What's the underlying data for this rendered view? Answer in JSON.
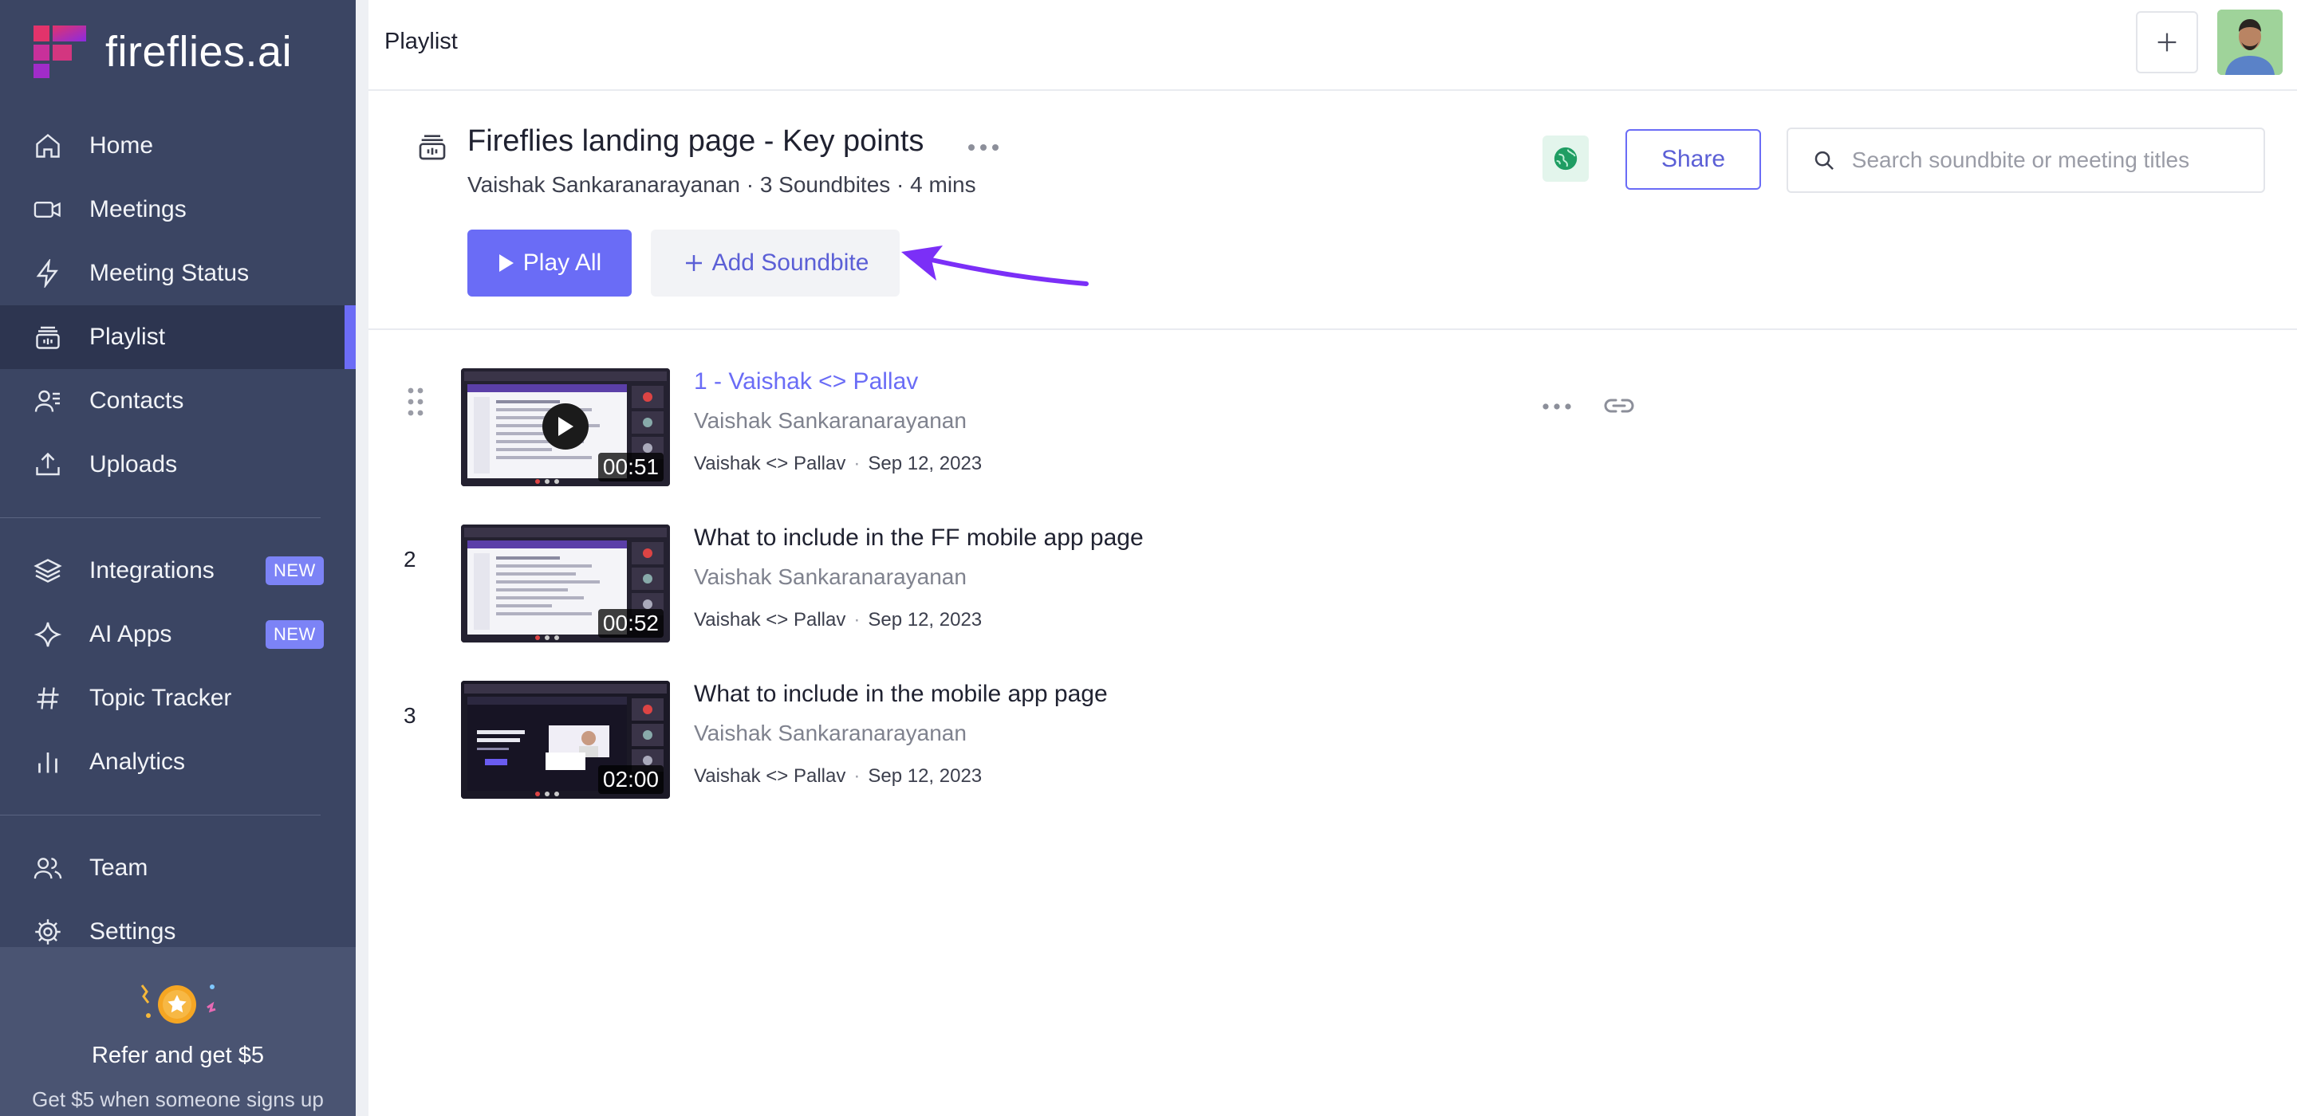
{
  "app": {
    "name": "fireflies.ai"
  },
  "colors": {
    "sidebar": "#3b4563",
    "accent": "#6a6cf6",
    "active": "#2d3550"
  },
  "sidebar": {
    "items": [
      {
        "label": "Home",
        "icon": "home-icon"
      },
      {
        "label": "Meetings",
        "icon": "video-icon"
      },
      {
        "label": "Meeting Status",
        "icon": "bolt-icon"
      },
      {
        "label": "Playlist",
        "icon": "playlist-icon",
        "active": true
      },
      {
        "label": "Contacts",
        "icon": "contacts-icon"
      },
      {
        "label": "Uploads",
        "icon": "upload-icon"
      }
    ],
    "items2": [
      {
        "label": "Integrations",
        "icon": "layers-icon",
        "badge": "NEW"
      },
      {
        "label": "AI Apps",
        "icon": "sparkle-icon",
        "badge": "NEW"
      },
      {
        "label": "Topic Tracker",
        "icon": "hash-icon"
      },
      {
        "label": "Analytics",
        "icon": "bar-chart-icon"
      }
    ],
    "items3": [
      {
        "label": "Team",
        "icon": "team-icon"
      },
      {
        "label": "Settings",
        "icon": "gear-icon"
      }
    ],
    "refer": {
      "title": "Refer and get $5",
      "subtitle": "Get $5 when someone signs up"
    }
  },
  "topbar": {
    "title": "Playlist"
  },
  "playlist": {
    "title": "Fireflies landing page - Key points",
    "meta": "Vaishak Sankaranarayanan · 3 Soundbites · 4 mins",
    "play_all": "Play All",
    "add_soundbite": "Add Soundbite",
    "share": "Share",
    "search_placeholder": "Search soundbite or meeting titles"
  },
  "soundbites": [
    {
      "index": "1",
      "title": "1 - Vaishak <> Pallav",
      "author": "Vaishak Sankaranarayanan",
      "meeting": "Vaishak <> Pallav",
      "date": "Sep 12, 2023",
      "duration": "00:51"
    },
    {
      "index": "2",
      "title": "What to include in the FF mobile app page",
      "author": "Vaishak Sankaranarayanan",
      "meeting": "Vaishak <> Pallav",
      "date": "Sep 12, 2023",
      "duration": "00:52"
    },
    {
      "index": "3",
      "title": "What to include in the mobile app page",
      "author": "Vaishak Sankaranarayanan",
      "meeting": "Vaishak <> Pallav",
      "date": "Sep 12, 2023",
      "duration": "02:00"
    }
  ]
}
